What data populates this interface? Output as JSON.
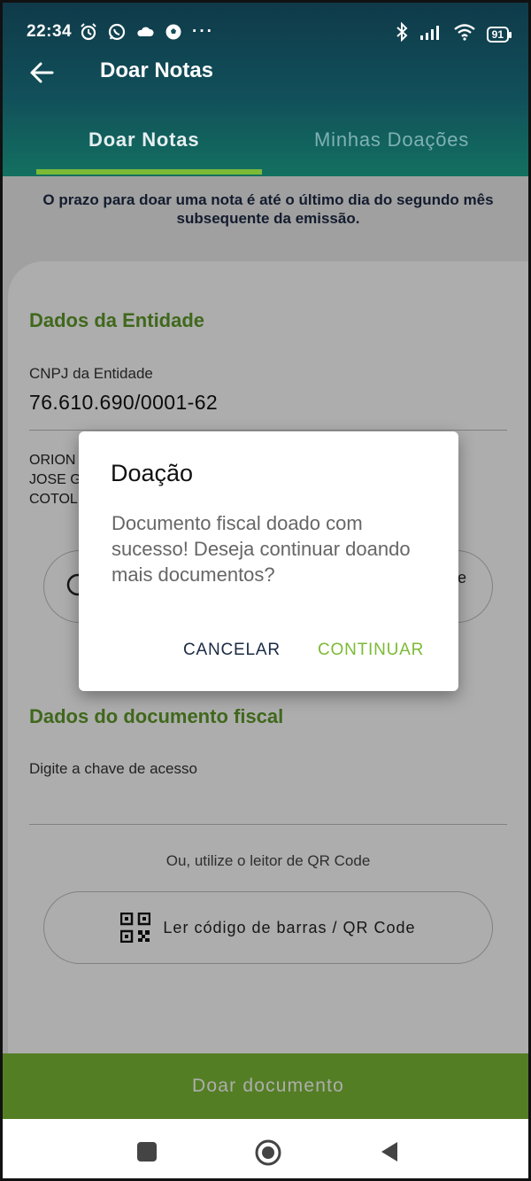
{
  "status_bar": {
    "time": "22:34",
    "battery": "91",
    "left_icons": [
      "alarm-icon",
      "whatsapp-icon",
      "cloud-icon",
      "soccer-ball-icon",
      "more-dots-icon"
    ],
    "right_icons": [
      "bluetooth-icon",
      "signal-icon",
      "wifi-icon",
      "battery-icon"
    ],
    "more": "···"
  },
  "appbar": {
    "title": "Doar Notas"
  },
  "tabs": [
    {
      "label": "Doar Notas",
      "active": true
    },
    {
      "label": "Minhas Doações",
      "active": false
    }
  ],
  "notice": "O prazo para doar uma nota é até o último dia do segundo mês subsequente da emissão.",
  "entity_section": {
    "title": "Dados da Entidade",
    "cnpj_label": "CNPJ da Entidade",
    "cnpj_value": "76.610.690/0001-62",
    "name_lines": [
      "ORION",
      "JOSE G",
      "COTOL"
    ],
    "partial_button_suffix": "e"
  },
  "fiscal_section": {
    "title": "Dados do documento fiscal",
    "access_key_label": "Digite a chave de acesso",
    "qr_hint": "Ou, utilize o leitor de QR Code",
    "qr_button_label": "Ler código de barras / QR Code"
  },
  "primary_button": "Doar documento",
  "dialog": {
    "title": "Doação",
    "message": "Documento fiscal doado com sucesso! Deseja continuar doando mais documentos?",
    "cancel_label": "CANCELAR",
    "continue_label": "CONTINUAR"
  },
  "colors": {
    "accent_green": "#7cba36",
    "section_green": "#5f9a2a",
    "navy": "#1c2a44",
    "header_top": "#0f3a4a",
    "header_bottom": "#137060"
  }
}
